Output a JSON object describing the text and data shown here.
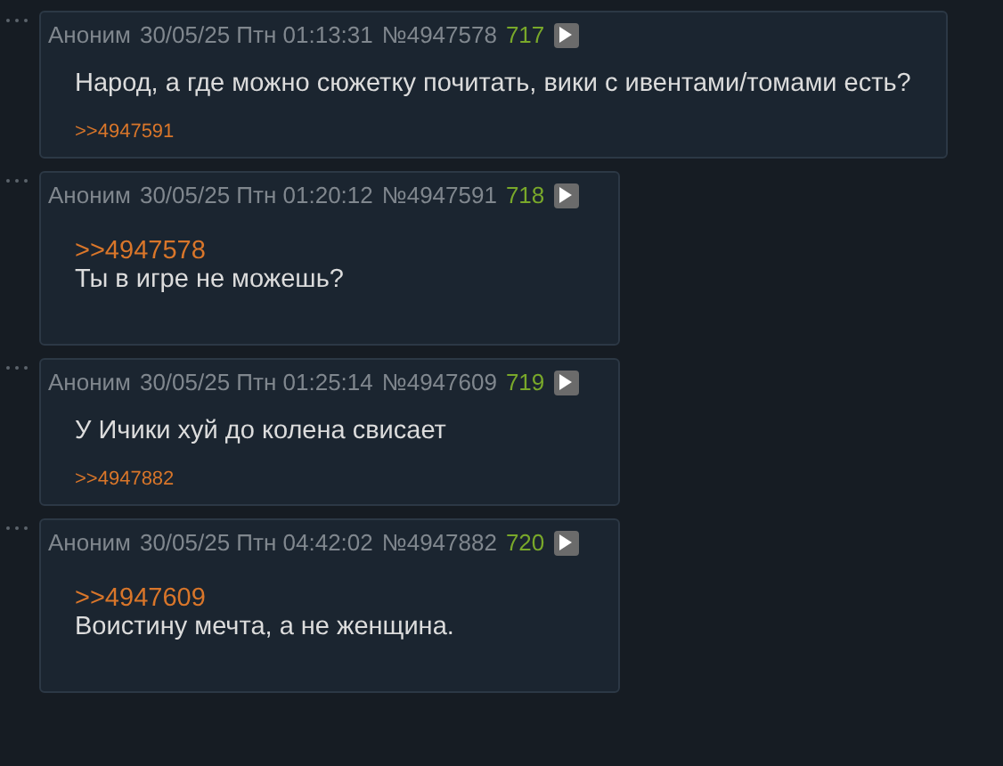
{
  "posts": [
    {
      "author": "Аноним",
      "date": "30/05/25 Птн 01:13:31",
      "number": "№4947578",
      "ordinal": "717",
      "text": "Народ, а где можно сюжетку почитать, вики с ивентами/томами есть?",
      "replies": [
        ">>4947591"
      ]
    },
    {
      "author": "Аноним",
      "date": "30/05/25 Птн 01:20:12",
      "number": "№4947591",
      "ordinal": "718",
      "quote": ">>4947578",
      "text": "Ты в игре не можешь?"
    },
    {
      "author": "Аноним",
      "date": "30/05/25 Птн 01:25:14",
      "number": "№4947609",
      "ordinal": "719",
      "text": "У Ичики хуй до колена свисает",
      "replies": [
        ">>4947882"
      ]
    },
    {
      "author": "Аноним",
      "date": "30/05/25 Птн 04:42:02",
      "number": "№4947882",
      "ordinal": "720",
      "quote": ">>4947609",
      "text": "Воистину мечта, а не женщина."
    }
  ]
}
